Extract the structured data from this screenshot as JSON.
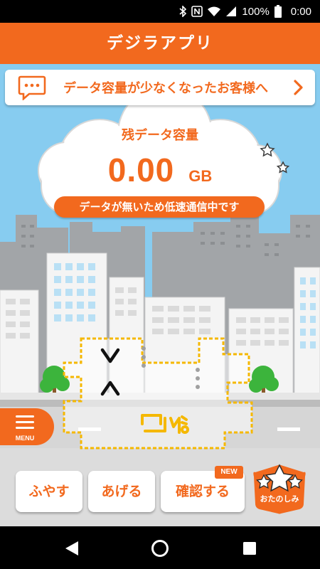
{
  "status_bar": {
    "battery_percent": "100%",
    "time": "0:00",
    "icons": [
      "bluetooth-icon",
      "nfc-icon",
      "wifi-icon",
      "signal-icon",
      "battery-icon"
    ]
  },
  "header": {
    "title": "デジラアプリ"
  },
  "notice": {
    "text": "データ容量が少なくなったお客様へ",
    "icon": "chat-bubble-icon"
  },
  "data_remaining": {
    "label": "残データ容量",
    "value": "0.00",
    "unit": "GB",
    "status_message": "データが無いため低速通信中です"
  },
  "menu": {
    "label": "MENU"
  },
  "actions": [
    {
      "label": "ふやす"
    },
    {
      "label": "あげる"
    },
    {
      "label": "確認する",
      "badge": "NEW"
    }
  ],
  "otanoshimi": {
    "label": "おたのしみ",
    "icon": "star-icon"
  },
  "colors": {
    "accent": "#f2691e",
    "sky": "#87ccf0",
    "mascot_outline": "#f5b800"
  },
  "navigation": {
    "icons": [
      "back-icon",
      "home-icon",
      "recents-icon"
    ]
  }
}
